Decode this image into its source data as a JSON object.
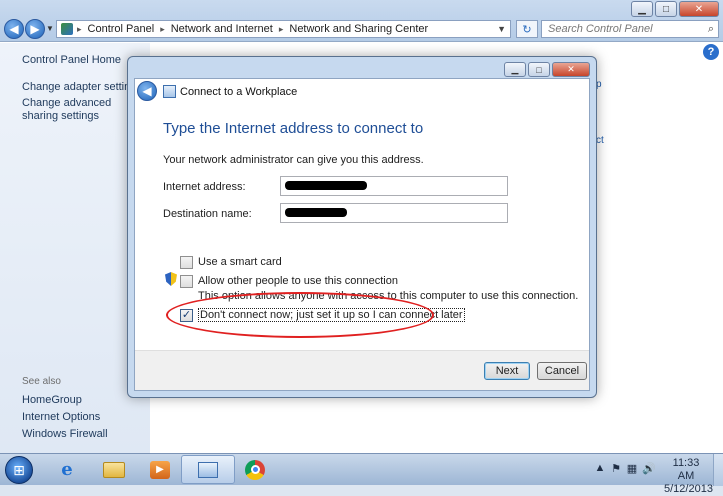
{
  "explorer": {
    "breadcrumbs": [
      "Control Panel",
      "Network and Internet",
      "Network and Sharing Center"
    ],
    "search_placeholder": "Search Control Panel",
    "left_links": [
      "Control Panel Home",
      "Change adapter settings",
      "Change advanced sharing settings"
    ],
    "see_also_label": "See also",
    "see_also_links": [
      "HomeGroup",
      "Internet Options",
      "Windows Firewall"
    ],
    "right_fragments": [
      "p",
      "ct"
    ]
  },
  "dialog": {
    "title": "Connect to a Workplace",
    "heading": "Type the Internet address to connect to",
    "info": "Your network administrator can give you this address.",
    "internet_address_label": "Internet address:",
    "destination_name_label": "Destination name:",
    "smart_card_label": "Use a smart card",
    "smart_card_checked": false,
    "allow_others_label": "Allow other people to use this connection",
    "allow_others_checked": false,
    "allow_others_hint": "This option allows anyone with access to this computer to use this connection.",
    "dont_connect_label": "Don't connect now; just set it up so I can connect later",
    "dont_connect_checked": true,
    "next_label": "Next",
    "cancel_label": "Cancel"
  },
  "taskbar": {
    "apps": [
      "internet-explorer",
      "windows-explorer",
      "media-player",
      "network-connections",
      "google-chrome"
    ],
    "clock_time": "11:33 AM",
    "clock_date": "5/12/2013"
  },
  "colors": {
    "heading_blue": "#1f4e96",
    "highlight_red": "#e02020"
  }
}
